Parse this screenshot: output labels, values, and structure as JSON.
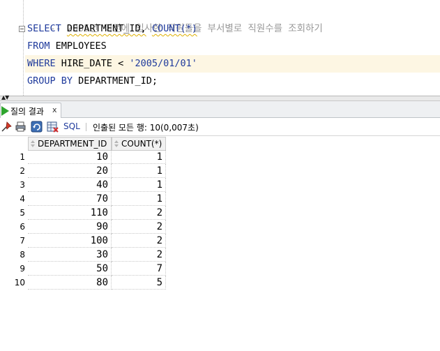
{
  "editor": {
    "comment_line": "-- 2005년 이전에 입사한 직원들을 부서별로 직원수를 조회하기",
    "line1": {
      "kw1": "SELECT",
      "col1": "DEPARTMENT_ID,",
      "fn": "COUNT(*)"
    },
    "line2": {
      "kw": "FROM",
      "table": "EMPLOYEES"
    },
    "line3": {
      "kw": "WHERE",
      "col": "HIRE_DATE",
      "op": "<",
      "value": "'2005/01/01'"
    },
    "line4": {
      "kw": "GROUP BY",
      "col": "DEPARTMENT_ID;"
    }
  },
  "results_tab": {
    "label": "질의 결과",
    "close": "x"
  },
  "toolbar": {
    "pin_icon": "pin-icon",
    "print_icon": "print-icon",
    "refresh_icon": "refresh-icon",
    "export_icon": "export-icon",
    "sql_label": "SQL",
    "separator": "|",
    "status": "인출된 모든 행: 10(0,007초)"
  },
  "grid": {
    "columns": [
      "DEPARTMENT_ID",
      "COUNT(*)"
    ],
    "rows": [
      {
        "num": "1",
        "dept": "10",
        "count": "1"
      },
      {
        "num": "2",
        "dept": "20",
        "count": "1"
      },
      {
        "num": "3",
        "dept": "40",
        "count": "1"
      },
      {
        "num": "4",
        "dept": "70",
        "count": "1"
      },
      {
        "num": "5",
        "dept": "110",
        "count": "2"
      },
      {
        "num": "6",
        "dept": "90",
        "count": "2"
      },
      {
        "num": "7",
        "dept": "100",
        "count": "2"
      },
      {
        "num": "8",
        "dept": "30",
        "count": "2"
      },
      {
        "num": "9",
        "dept": "50",
        "count": "7"
      },
      {
        "num": "10",
        "dept": "80",
        "count": "5"
      }
    ]
  },
  "colors": {
    "keyword": "#1f3a9c",
    "comment": "#999999",
    "current_line": "#fdf6e3",
    "run_icon": "#2fa52f"
  }
}
